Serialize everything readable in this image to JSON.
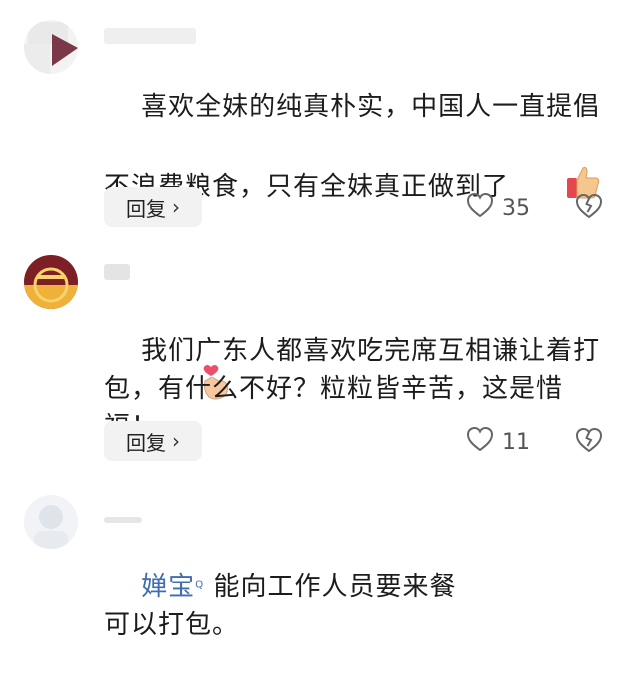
{
  "comments": [
    {
      "text": "喜欢全妹的纯真朴实，中国人一直提倡不浪费粮食，只有全妹真正做到了",
      "reply_label": "回复",
      "likes": "35"
    },
    {
      "text": "我们广东人都喜欢吃完席互相谦让着打包，有什么不好？粒粒皆辛苦，这是惜福！",
      "reply_label": "回复",
      "likes": "11"
    },
    {
      "reply_name": "婵宝",
      "text_line1": " 能向工作人员要来餐",
      "text_line2": "可以打包。"
    }
  ],
  "icons": {
    "thumbs_up": "thumbs-up-emoji",
    "heart_hand": "finger-heart-emoji",
    "like": "heart-outline-icon",
    "dislike": "broken-heart-icon",
    "chevron": "chevron-right-icon"
  },
  "colors": {
    "reply_name": "#3f6db1",
    "reply_button_bg": "#f2f2f2"
  }
}
